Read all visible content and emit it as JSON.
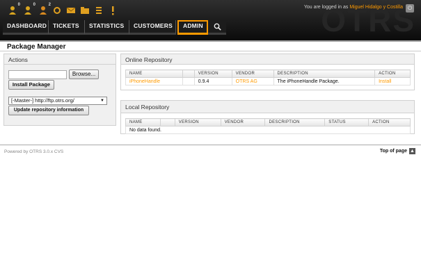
{
  "header": {
    "watermark": "OTRS",
    "login_prefix": "You are logged in as",
    "login_user": "Miguel Hidalgo y Costilla",
    "toolbar_counts": [
      "0",
      "0",
      "2"
    ]
  },
  "nav": {
    "tabs": [
      "DASHBOARD",
      "TICKETS",
      "STATISTICS",
      "CUSTOMERS",
      "ADMIN"
    ]
  },
  "page_title": "Package Manager",
  "actions": {
    "heading": "Actions",
    "browse_label": "Browse...",
    "install_label": "Install Package",
    "repo_select_value": "[-Master-] http://ftp.otrs.org/",
    "update_label": "Update repository information"
  },
  "online_repo": {
    "heading": "Online Repository",
    "columns": [
      "NAME",
      "VERSION",
      "VENDOR",
      "DESCRIPTION",
      "ACTION"
    ],
    "rows": [
      {
        "name": "iPhoneHandle",
        "version": "0.9.4",
        "vendor": "OTRS AG",
        "description": "The iPhoneHandle Package.",
        "action": "Install"
      }
    ]
  },
  "local_repo": {
    "heading": "Local Repository",
    "columns": [
      "NAME",
      "VERSION",
      "VENDOR",
      "DESCRIPTION",
      "STATUS",
      "ACTION"
    ],
    "empty_text": "No data found."
  },
  "footer": {
    "powered_by": "Powered by OTRS 3.0.x CVS",
    "top_label": "Top of page"
  },
  "colors": {
    "accent": "#ff9a00",
    "header_bg": "#1a1a1a"
  }
}
